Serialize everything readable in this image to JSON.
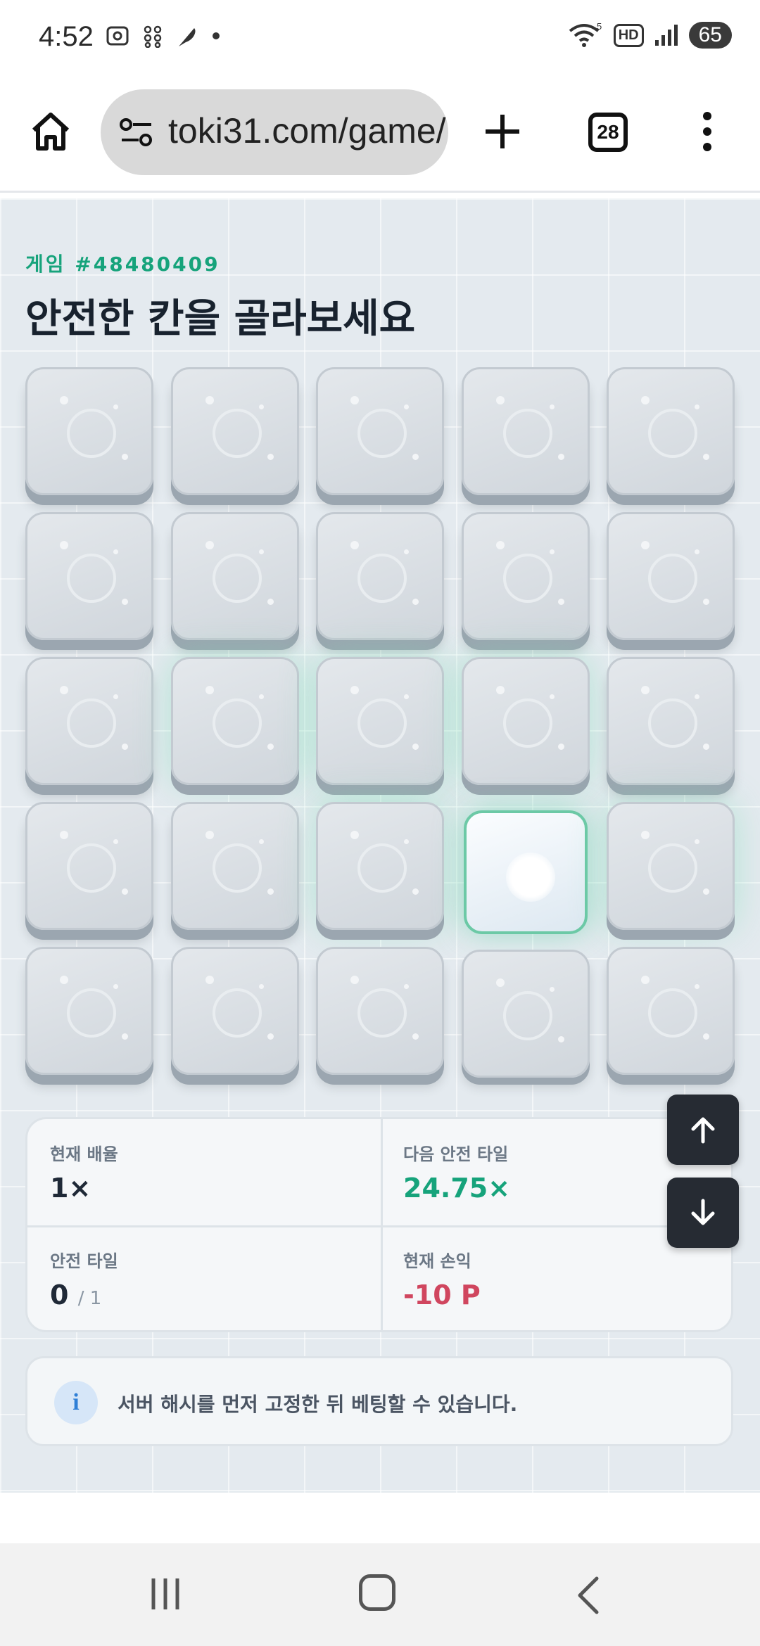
{
  "status_bar": {
    "time": "4:52",
    "hd_label": "HD",
    "wifi_label": "5",
    "battery": "65"
  },
  "browser": {
    "url": "toki31.com/game/",
    "tab_count": "28"
  },
  "game": {
    "id_label": "게임 #48480409",
    "title": "안전한 칸을 골라보세요",
    "grid": {
      "rows": 5,
      "cols": 5,
      "selected_tile": [
        3,
        3
      ]
    }
  },
  "stats": {
    "current_multiplier_label": "현재 배율",
    "current_multiplier_value": "1×",
    "next_safe_label": "다음 안전 타일",
    "next_safe_value": "24.75×",
    "safe_tiles_label": "안전 타일",
    "safe_tiles_value": "0",
    "safe_tiles_total": "/ 1",
    "profit_label": "현재 손익",
    "profit_value": "-10 P"
  },
  "info": {
    "icon": "i",
    "message": "서버 해시를 먼저 고정한 뒤 베팅할 수 있습니다."
  },
  "colors": {
    "accent_green": "#16a37b",
    "loss_red": "#d0465f",
    "selected_border": "#6cc9a6"
  }
}
